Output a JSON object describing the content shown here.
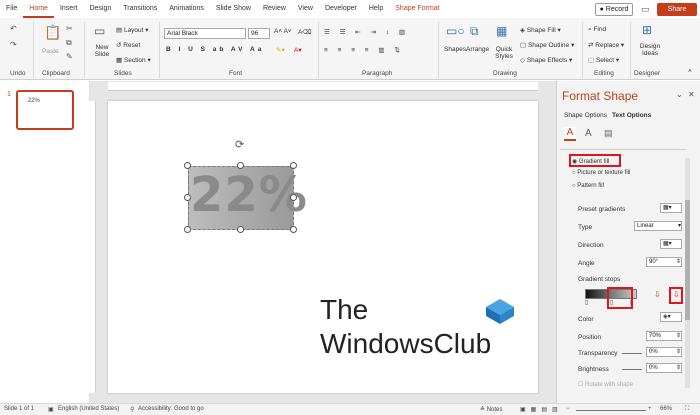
{
  "menu": {
    "items": [
      "File",
      "Home",
      "Insert",
      "Design",
      "Transitions",
      "Animations",
      "Slide Show",
      "Review",
      "View",
      "Developer",
      "Help",
      "Shape Format"
    ],
    "active": "Home",
    "record": "Record",
    "share": "Share"
  },
  "ribbon": {
    "groups": {
      "undo": "Undo",
      "clipboard": "Clipboard",
      "slides": "Slides",
      "font": "Font",
      "paragraph": "Paragraph",
      "drawing": "Drawing",
      "editing": "Editing",
      "designer": "Designer"
    },
    "paste": "Paste",
    "new_slide": "New Slide",
    "layout": "Layout",
    "reset": "Reset",
    "section": "Section",
    "font_name": "Arial Black",
    "font_size": "96",
    "shapes": "Shapes",
    "arrange": "Arrange",
    "quick_styles": "Quick Styles",
    "shape_fill": "Shape Fill",
    "shape_outline": "Shape Outline",
    "shape_effects": "Shape Effects",
    "find": "Find",
    "replace": "Replace",
    "select": "Select",
    "design_ideas": "Design Ideas"
  },
  "thumbs": {
    "number": "1",
    "text": "22%"
  },
  "slide": {
    "text": "22%",
    "logo_line1": "The",
    "logo_line2": "WindowsClub"
  },
  "pane": {
    "title": "Format Shape",
    "tab1": "Shape Options",
    "tab2": "Text Options",
    "gradient_fill": "Gradient fill",
    "picture_fill": "Picture or texture fill",
    "pattern_fill": "Pattern fill",
    "preset": "Preset gradients",
    "type_label": "Type",
    "type_value": "Linear",
    "direction": "Direction",
    "angle_label": "Angle",
    "angle_value": "90°",
    "gradient_stops": "Gradient stops",
    "color": "Color",
    "position_label": "Position",
    "position_value": "70%",
    "transparency_label": "Transparency",
    "transparency_value": "0%",
    "brightness_label": "Brightness",
    "brightness_value": "0%",
    "rotate": "Rotate with shape"
  },
  "status": {
    "slide": "Slide 1 of 1",
    "language": "English (United States)",
    "accessibility": "Accessibility: Good to go",
    "notes": "Notes",
    "zoom": "66%"
  },
  "colors": {
    "accent": "#c43e1c",
    "highlight": "#e0141e"
  }
}
